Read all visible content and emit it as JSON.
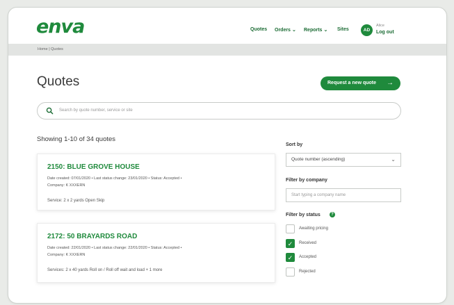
{
  "header": {
    "logo": "enva",
    "nav": {
      "quotes": "Quotes",
      "orders": "Orders",
      "reports": "Reports",
      "sites": "Sites"
    },
    "user": {
      "initials": "AD",
      "name": "Alice",
      "logout": "Log out"
    }
  },
  "breadcrumb": "Home | Quotes",
  "page": {
    "title": "Quotes",
    "request_button": "Request a new quote",
    "search_placeholder": "Search by quote number, service or site",
    "showing": "Showing 1-10 of 34 quotes"
  },
  "quotes": [
    {
      "title": "2150: BLUE GROVE HOUSE",
      "meta_line1": "Date created: 07/01/2020  •  Last status change: 23/01/2020  •  Status: Accepted  •",
      "meta_line2": "Company: K       XXXERN",
      "service": "Service: 2 x 2 yards Open Skip"
    },
    {
      "title": "2172: 50 BRAYARDS ROAD",
      "meta_line1": "Date created: 22/01/2020  •  Last status change: 22/01/2020  •  Status: Accepted  •",
      "meta_line2": "Company: K       XXXERN",
      "service": "Services: 2 x 40 yards Roll on / Roll off wait and load + 1 more"
    }
  ],
  "filters": {
    "sort_label": "Sort by",
    "sort_value": "Quote number (ascending)",
    "company_label": "Filter by company",
    "company_placeholder": "Start typing a company name",
    "status_label": "Filter by status",
    "status_options": [
      {
        "label": "Awaiting pricing",
        "checked": false
      },
      {
        "label": "Received",
        "checked": true
      },
      {
        "label": "Accepted",
        "checked": true
      },
      {
        "label": "Rejected",
        "checked": false
      }
    ]
  },
  "colors": {
    "brand_green": "#1f8a3c",
    "nav_green": "#1a6b33",
    "page_bg": "#e9ebe8"
  }
}
